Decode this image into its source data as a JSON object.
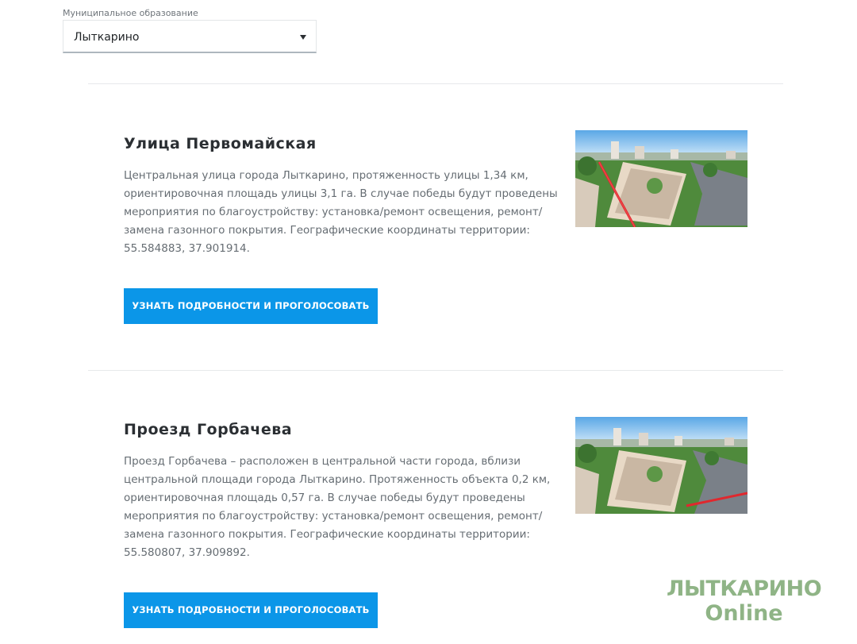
{
  "municipality_select": {
    "label": "Муниципальное образование",
    "value": "Лыткарино"
  },
  "items": [
    {
      "title": "Улица Первомайская",
      "description_lines": [
        "Центральная улица города Лыткарино, протяженность улицы 1,34 км,",
        "ориентировочная площадь улицы 3,1 га. В случае победы будут проведены",
        "мероприятия по благоустройству: установка/ремонт освещения, ремонт/",
        "замена газонного покрытия. Географические координаты территории:",
        "55.584883, 37.901914."
      ],
      "button_label": "УЗНАТЬ ПОДРОБНОСТИ И ПРОГОЛОСОВАТЬ"
    },
    {
      "title": "Проезд Горбачева",
      "description_lines": [
        "Проезд Горбачева – расположен в центральной части города, вблизи",
        "центральной площади города Лыткарино. Протяженность объекта 0,2 км,",
        "ориентировочная площадь 0,57 га. В случае победы будут проведены",
        "мероприятия по благоустройству: установка/ремонт освещения, ремонт/",
        "замена газонного покрытия. Географические координаты территории:",
        "55.580807, 37.909892."
      ],
      "button_label": "УЗНАТЬ ПОДРОБНОСТИ И ПРОГОЛОСОВАТЬ"
    }
  ],
  "watermark": {
    "line1": "ЛЫТКАРИНО",
    "line2": "Online"
  },
  "colors": {
    "button": "#0b96e8",
    "watermark": "#8fb486",
    "highlight_route": "#e0282e"
  }
}
